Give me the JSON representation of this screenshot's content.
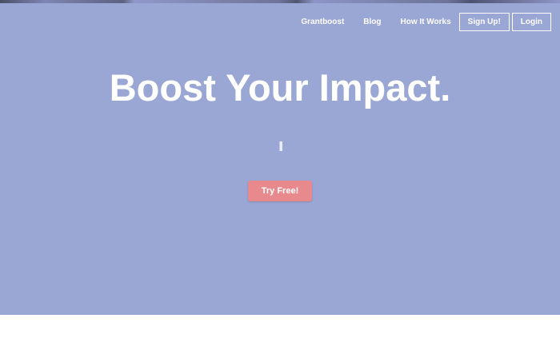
{
  "nav": {
    "links": [
      {
        "label": "Grantboost"
      },
      {
        "label": "Blog"
      },
      {
        "label": "How It Works"
      }
    ],
    "signup_label": "Sign Up!",
    "login_label": "Login"
  },
  "hero": {
    "headline": "Boost Your Impact.",
    "cta_label": "Try Free!"
  },
  "colors": {
    "hero_background": "#9aa6d4",
    "cta_background": "#e88a8d",
    "text": "#ffffff"
  }
}
